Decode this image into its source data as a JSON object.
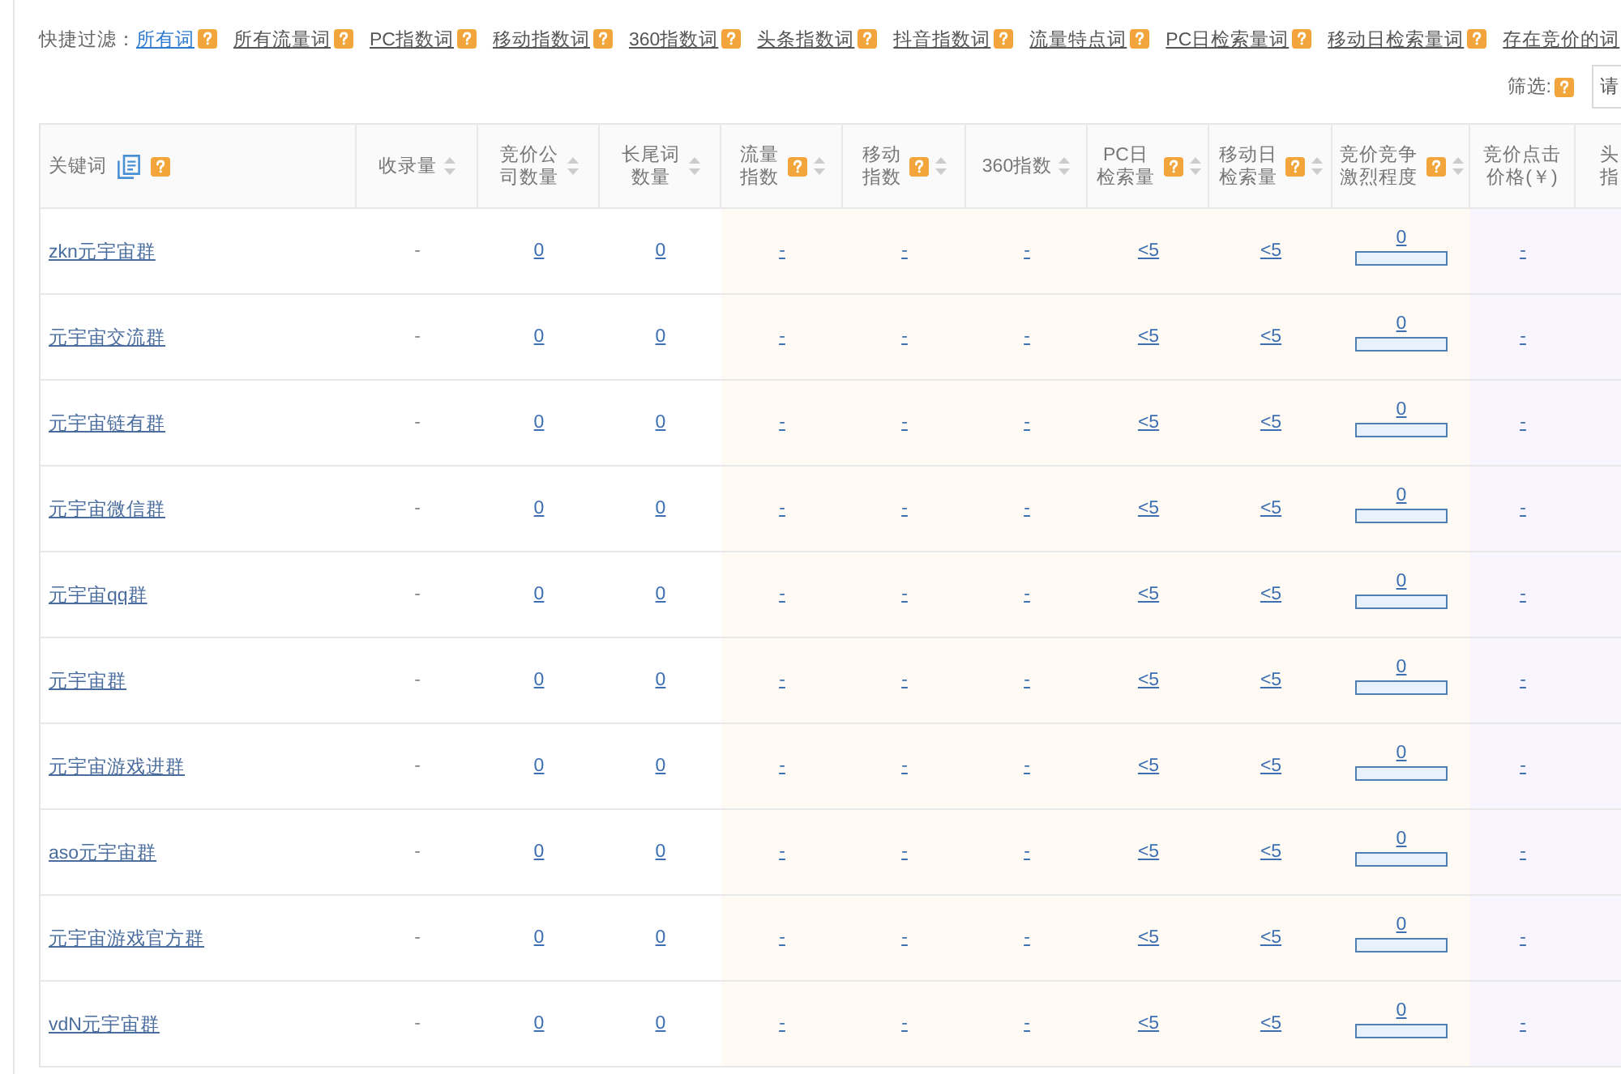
{
  "filter_bar": {
    "label": "快捷过滤：",
    "items": [
      {
        "label": "所有词",
        "selected": true,
        "help": true
      },
      {
        "label": "所有流量词",
        "selected": false,
        "help": true
      },
      {
        "label": "PC指数词",
        "selected": false,
        "help": true
      },
      {
        "label": "移动指数词",
        "selected": false,
        "help": true
      },
      {
        "label": "360指数词",
        "selected": false,
        "help": true
      },
      {
        "label": "头条指数词",
        "selected": false,
        "help": true
      },
      {
        "label": "抖音指数词",
        "selected": false,
        "help": true
      },
      {
        "label": "流量特点词",
        "selected": false,
        "help": true
      },
      {
        "label": "PC日检索量词",
        "selected": false,
        "help": true
      },
      {
        "label": "移动日检索量词",
        "selected": false,
        "help": true
      },
      {
        "label": "存在竞价的词",
        "selected": false,
        "help": false
      }
    ]
  },
  "screen_filter": {
    "label": "筛选:",
    "help": true,
    "select": {
      "placeholder": "请"
    }
  },
  "table": {
    "columns": [
      {
        "label": "关键词",
        "kind": "keyword",
        "copy": true,
        "help": true,
        "sortable": false
      },
      {
        "label": "收录量",
        "kind": "metric",
        "help": false,
        "sortable": true
      },
      {
        "label": "竞价公司数量",
        "kind": "metric",
        "help": false,
        "sortable": true
      },
      {
        "label": "长尾词数量",
        "kind": "metric",
        "help": false,
        "sortable": true
      },
      {
        "label": "流量指数",
        "kind": "traffic",
        "help": true,
        "sortable": true
      },
      {
        "label": "移动指数",
        "kind": "traffic",
        "help": true,
        "sortable": true
      },
      {
        "label": "360指数",
        "kind": "traffic",
        "help": false,
        "sortable": true
      },
      {
        "label": "PC日检索量",
        "kind": "traffic",
        "help": true,
        "sortable": true
      },
      {
        "label": "移动日检索量",
        "kind": "traffic",
        "help": true,
        "sortable": true
      },
      {
        "label": "竞价竞争激烈程度",
        "kind": "traffic",
        "help": true,
        "sortable": true
      },
      {
        "label": "竞价点击价格(￥)",
        "kind": "bid",
        "help": false,
        "sortable": false
      },
      {
        "label": "头指",
        "kind": "edge",
        "help": false,
        "sortable": false
      }
    ],
    "rows": [
      {
        "cells": [
          {
            "kind": "keyword",
            "value": "zkn元宇宙群"
          },
          {
            "kind": "text",
            "value": "-"
          },
          {
            "kind": "link",
            "value": "0"
          },
          {
            "kind": "link",
            "value": "0"
          },
          {
            "kind": "link",
            "value": "-"
          },
          {
            "kind": "link",
            "value": "-"
          },
          {
            "kind": "link",
            "value": "-"
          },
          {
            "kind": "link",
            "value": "<5"
          },
          {
            "kind": "link",
            "value": "<5"
          },
          {
            "kind": "meter",
            "value": "0",
            "level": 0
          },
          {
            "kind": "link",
            "value": "-"
          }
        ]
      },
      {
        "cells": [
          {
            "kind": "keyword",
            "value": "元宇宙交流群"
          },
          {
            "kind": "text",
            "value": "-"
          },
          {
            "kind": "link",
            "value": "0"
          },
          {
            "kind": "link",
            "value": "0"
          },
          {
            "kind": "link",
            "value": "-"
          },
          {
            "kind": "link",
            "value": "-"
          },
          {
            "kind": "link",
            "value": "-"
          },
          {
            "kind": "link",
            "value": "<5"
          },
          {
            "kind": "link",
            "value": "<5"
          },
          {
            "kind": "meter",
            "value": "0",
            "level": 0
          },
          {
            "kind": "link",
            "value": "-"
          }
        ]
      },
      {
        "cells": [
          {
            "kind": "keyword",
            "value": "元宇宙链有群"
          },
          {
            "kind": "text",
            "value": "-"
          },
          {
            "kind": "link",
            "value": "0"
          },
          {
            "kind": "link",
            "value": "0"
          },
          {
            "kind": "link",
            "value": "-"
          },
          {
            "kind": "link",
            "value": "-"
          },
          {
            "kind": "link",
            "value": "-"
          },
          {
            "kind": "link",
            "value": "<5"
          },
          {
            "kind": "link",
            "value": "<5"
          },
          {
            "kind": "meter",
            "value": "0",
            "level": 0
          },
          {
            "kind": "link",
            "value": "-"
          }
        ]
      },
      {
        "cells": [
          {
            "kind": "keyword",
            "value": "元宇宙微信群"
          },
          {
            "kind": "text",
            "value": "-"
          },
          {
            "kind": "link",
            "value": "0"
          },
          {
            "kind": "link",
            "value": "0"
          },
          {
            "kind": "link",
            "value": "-"
          },
          {
            "kind": "link",
            "value": "-"
          },
          {
            "kind": "link",
            "value": "-"
          },
          {
            "kind": "link",
            "value": "<5"
          },
          {
            "kind": "link",
            "value": "<5"
          },
          {
            "kind": "meter",
            "value": "0",
            "level": 0
          },
          {
            "kind": "link",
            "value": "-"
          }
        ]
      },
      {
        "cells": [
          {
            "kind": "keyword",
            "value": "元宇宙qq群"
          },
          {
            "kind": "text",
            "value": "-"
          },
          {
            "kind": "link",
            "value": "0"
          },
          {
            "kind": "link",
            "value": "0"
          },
          {
            "kind": "link",
            "value": "-"
          },
          {
            "kind": "link",
            "value": "-"
          },
          {
            "kind": "link",
            "value": "-"
          },
          {
            "kind": "link",
            "value": "<5"
          },
          {
            "kind": "link",
            "value": "<5"
          },
          {
            "kind": "meter",
            "value": "0",
            "level": 0
          },
          {
            "kind": "link",
            "value": "-"
          }
        ]
      },
      {
        "cells": [
          {
            "kind": "keyword",
            "value": "元宇宙群"
          },
          {
            "kind": "text",
            "value": "-"
          },
          {
            "kind": "link",
            "value": "0"
          },
          {
            "kind": "link",
            "value": "0"
          },
          {
            "kind": "link",
            "value": "-"
          },
          {
            "kind": "link",
            "value": "-"
          },
          {
            "kind": "link",
            "value": "-"
          },
          {
            "kind": "link",
            "value": "<5"
          },
          {
            "kind": "link",
            "value": "<5"
          },
          {
            "kind": "meter",
            "value": "0",
            "level": 0
          },
          {
            "kind": "link",
            "value": "-"
          }
        ]
      },
      {
        "cells": [
          {
            "kind": "keyword",
            "value": "元宇宙游戏进群"
          },
          {
            "kind": "text",
            "value": "-"
          },
          {
            "kind": "link",
            "value": "0"
          },
          {
            "kind": "link",
            "value": "0"
          },
          {
            "kind": "link",
            "value": "-"
          },
          {
            "kind": "link",
            "value": "-"
          },
          {
            "kind": "link",
            "value": "-"
          },
          {
            "kind": "link",
            "value": "<5"
          },
          {
            "kind": "link",
            "value": "<5"
          },
          {
            "kind": "meter",
            "value": "0",
            "level": 0
          },
          {
            "kind": "link",
            "value": "-"
          }
        ]
      },
      {
        "cells": [
          {
            "kind": "keyword",
            "value": "aso元宇宙群"
          },
          {
            "kind": "text",
            "value": "-"
          },
          {
            "kind": "link",
            "value": "0"
          },
          {
            "kind": "link",
            "value": "0"
          },
          {
            "kind": "link",
            "value": "-"
          },
          {
            "kind": "link",
            "value": "-"
          },
          {
            "kind": "link",
            "value": "-"
          },
          {
            "kind": "link",
            "value": "<5"
          },
          {
            "kind": "link",
            "value": "<5"
          },
          {
            "kind": "meter",
            "value": "0",
            "level": 0
          },
          {
            "kind": "link",
            "value": "-"
          }
        ]
      },
      {
        "cells": [
          {
            "kind": "keyword",
            "value": "元宇宙游戏官方群"
          },
          {
            "kind": "text",
            "value": "-"
          },
          {
            "kind": "link",
            "value": "0"
          },
          {
            "kind": "link",
            "value": "0"
          },
          {
            "kind": "link",
            "value": "-"
          },
          {
            "kind": "link",
            "value": "-"
          },
          {
            "kind": "link",
            "value": "-"
          },
          {
            "kind": "link",
            "value": "<5"
          },
          {
            "kind": "link",
            "value": "<5"
          },
          {
            "kind": "meter",
            "value": "0",
            "level": 0
          },
          {
            "kind": "link",
            "value": "-"
          }
        ]
      },
      {
        "cells": [
          {
            "kind": "keyword",
            "value": "vdN元宇宙群"
          },
          {
            "kind": "text",
            "value": "-"
          },
          {
            "kind": "link",
            "value": "0"
          },
          {
            "kind": "link",
            "value": "0"
          },
          {
            "kind": "link",
            "value": "-"
          },
          {
            "kind": "link",
            "value": "-"
          },
          {
            "kind": "link",
            "value": "-"
          },
          {
            "kind": "link",
            "value": "<5"
          },
          {
            "kind": "link",
            "value": "<5"
          },
          {
            "kind": "meter",
            "value": "0",
            "level": 0
          },
          {
            "kind": "link",
            "value": "-"
          }
        ]
      }
    ]
  }
}
